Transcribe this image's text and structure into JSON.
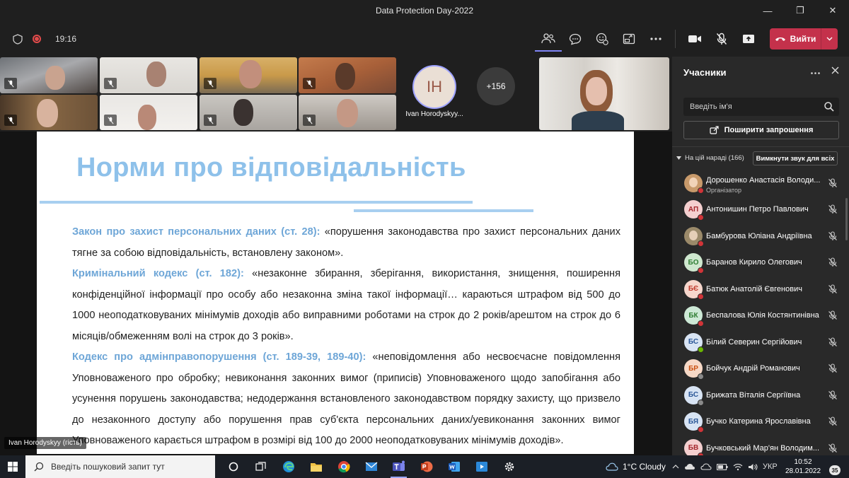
{
  "window": {
    "title": "Data Protection Day-2022",
    "controls": [
      "minimize",
      "restore",
      "close"
    ]
  },
  "toolbar": {
    "meeting_time": "19:16",
    "leave_label": "Вийти",
    "icons": [
      "people-icon",
      "chat-icon",
      "reactions-icon",
      "rooms-icon",
      "more-icon",
      "camera-icon",
      "mic-off-icon",
      "share-icon"
    ],
    "accent": "#c4314b"
  },
  "videos": {
    "participant_name": "Ivan Horodyskyy...",
    "participant_initials": "ІН",
    "more_count": "+156"
  },
  "slide": {
    "title": "Норми про відповідальність",
    "presenter_label": "Ivan Horodyskyy (гість)",
    "paragraphs": [
      {
        "keyword": "Закон про захист персональних даних (ст. 28):",
        "text": " «порушення законодавства про захист персональних даних тягне за собою відповідальність, встановлену законом»."
      },
      {
        "keyword": "Кримінальний кодекс (ст. 182):",
        "text": " «незаконне збирання, зберігання, використання, знищення, поширення конфіденційної інформації про особу або незаконна зміна такої інформації… караються штрафом від 500 до 1000 неоподатковуваних мінімумів доходів або виправними роботами на строк до 2 років/арештом на строк до 6 місяців/обмеженням волі на строк до 3 років»."
      },
      {
        "keyword": "Кодекс про адмінправопорушення (ст. 189-39, 189-40):",
        "text": " «неповідомлення або несвоєчасне повідомлення Уповноваженого про обробку; невиконання законних вимог (приписів) Уповноваженого щодо запобігання або усунення порушень законодавства; недодержання встановленого законодавством порядку захисту, що призвело до незаконного доступу або порушення прав суб'єкта персональних даних/уевиконання законних вимог Уповноваженого карається штрафом в розмірі від 100 до 2000 неоподатковуваних мінімумів доходів»."
      }
    ]
  },
  "participants_panel": {
    "title": "Учасники",
    "search_placeholder": "Введіть ім'я",
    "invite_label": "Поширити запрошення",
    "section_label": "На цій нараді (166)",
    "mute_all_label": "Вимкнути звук для всіх",
    "items": [
      {
        "name": "Дорошенко Анастасія Володи...",
        "role": "Організатор",
        "initials": "",
        "avatar_color": "#c89a6b",
        "text_color": "#ffffff",
        "status_color": "#d13438"
      },
      {
        "name": "Антонишин Петро Павлович",
        "role": "",
        "initials": "АП",
        "avatar_color": "#f4cfcf",
        "text_color": "#a4262c",
        "status_color": "#d13438"
      },
      {
        "name": "Бамбурова Юліана Андріївна",
        "role": "",
        "initials": "",
        "avatar_color": "#9b8a6a",
        "text_color": "#ffffff",
        "status_color": "#d13438"
      },
      {
        "name": "Баранов Кирило Олегович",
        "role": "",
        "initials": "БО",
        "avatar_color": "#cfe8cf",
        "text_color": "#2e7d32",
        "status_color": "#d13438"
      },
      {
        "name": "Батюк Анатолій Євгенович",
        "role": "",
        "initials": "БЄ",
        "avatar_color": "#f6d6cc",
        "text_color": "#c0392b",
        "status_color": "#d13438"
      },
      {
        "name": "Беспалова Юлія Костянтинівна",
        "role": "",
        "initials": "БК",
        "avatar_color": "#cde9d6",
        "text_color": "#2e7d32",
        "status_color": "#d13438"
      },
      {
        "name": "Білий Северин Сергійович",
        "role": "",
        "initials": "БС",
        "avatar_color": "#d8e4f4",
        "text_color": "#2b5797",
        "status_color": "#6bb700"
      },
      {
        "name": "Бойчук Андрій Романович",
        "role": "",
        "initials": "БР",
        "avatar_color": "#f7d9c7",
        "text_color": "#ca5010",
        "status_color": "#8a8a8a"
      },
      {
        "name": "Брижата Віталія Сергіївна",
        "role": "",
        "initials": "БС",
        "avatar_color": "#d8e4f4",
        "text_color": "#2b5797",
        "status_color": "#8a8a8a"
      },
      {
        "name": "Бучко Катерина Ярославівна",
        "role": "",
        "initials": "БЯ",
        "avatar_color": "#d8e4f4",
        "text_color": "#2b5797",
        "status_color": "#d13438"
      },
      {
        "name": "Бучковський Мар'ян Володим...",
        "role": "",
        "initials": "БВ",
        "avatar_color": "#f4cfcf",
        "text_color": "#a4262c",
        "status_color": "#d13438"
      }
    ]
  },
  "taskbar": {
    "search_placeholder": "Введіть пошуковий запит тут",
    "weather": "1°C  Cloudy",
    "language": "УКР",
    "time": "10:52",
    "date": "28.01.2022",
    "notification_count": "35"
  }
}
